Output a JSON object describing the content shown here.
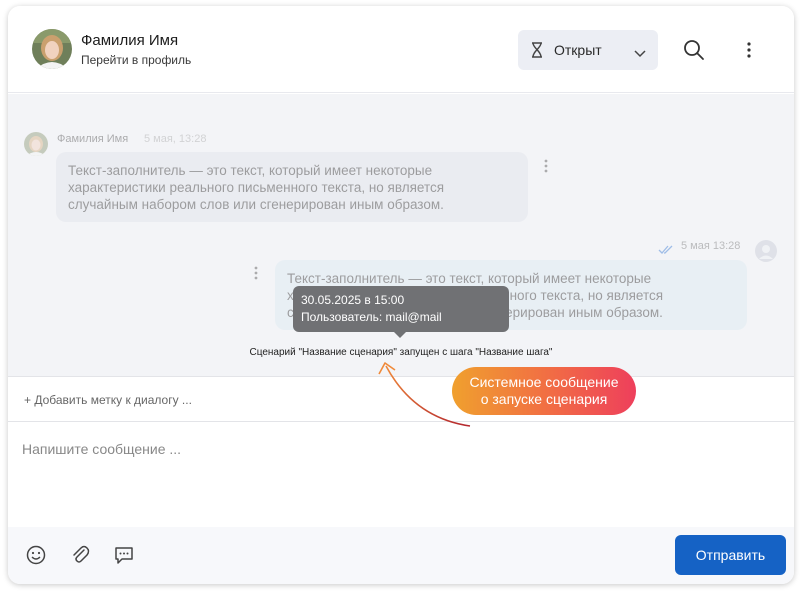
{
  "header": {
    "contact_name": "Фамилия Имя",
    "profile_link": "Перейти в профиль",
    "status_label": "Открыт",
    "icons": {
      "status": "hourglass-icon",
      "chevron": "chevron-down-icon",
      "search": "search-icon",
      "more": "more-vertical-icon"
    }
  },
  "chat": {
    "incoming": {
      "author": "Фамилия Имя",
      "time": "5 мая, 13:28",
      "text": "Текст-заполнитель — это текст, который имеет некоторые характеристики реального письменного текста, но является случайным набором слов или сгенерирован иным образом."
    },
    "outgoing": {
      "time": "5 мая 13:28",
      "text": "Текст-заполнитель — это текст, который имеет некоторые характеристики реального письменного текста, но является случайным набором слов или сгенерирован иным образом."
    },
    "tooltip": {
      "date": "30.05.2025 в 15:00",
      "user": "Пользователь: mail@mail"
    },
    "system_message": "Сценарий \"Название сценария\" запущен с шага \"Название шага\""
  },
  "tag_row": {
    "label": "+ Добавить метку к диалогу ..."
  },
  "composer": {
    "placeholder": "Напишите сообщение ..."
  },
  "toolbar": {
    "send_label": "Отправить",
    "icons": [
      "emoji-icon",
      "attach-icon",
      "quick-reply-icon"
    ]
  },
  "annotation": {
    "line1": "Системное сообщение",
    "line2": "о запуске сценария"
  },
  "colors": {
    "accent": "#1562c5",
    "chat_bg": "#f3f4f7",
    "tooltip_bg": "#707174",
    "callout_gradient_start": "#f0a02e",
    "callout_gradient_end": "#ee3f5c"
  }
}
